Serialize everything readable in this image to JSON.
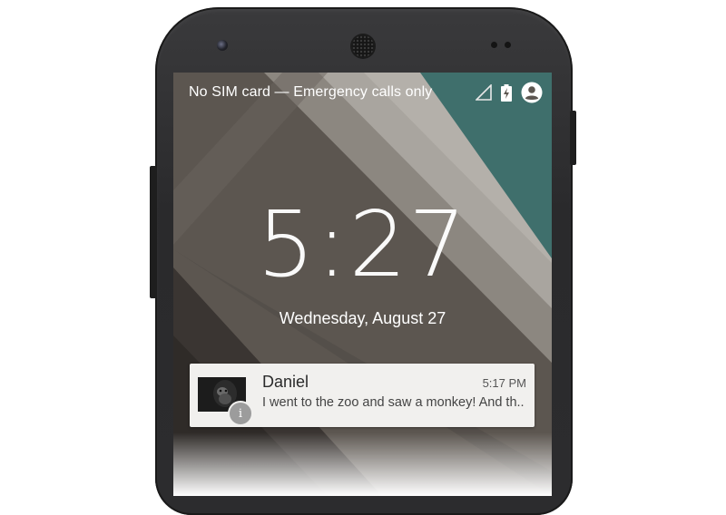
{
  "status_bar": {
    "carrier_text": "No SIM card — Emergency calls only",
    "icons": [
      "no-signal-icon",
      "battery-charging-icon",
      "user-account-icon"
    ]
  },
  "lock_screen": {
    "time": "5:27",
    "date": "Wednesday, August 27"
  },
  "notification": {
    "sender": "Daniel",
    "time": "5:17 PM",
    "message": "I went to the zoo and saw a monkey! And th..",
    "badge_icon": "info-icon"
  },
  "colors": {
    "wallpaper_teal": "#3f6f6c",
    "wallpaper_light_stripe": "#a9a59f",
    "wallpaper_base": "#5f5a54",
    "notification_bg": "#f1f0ee"
  }
}
